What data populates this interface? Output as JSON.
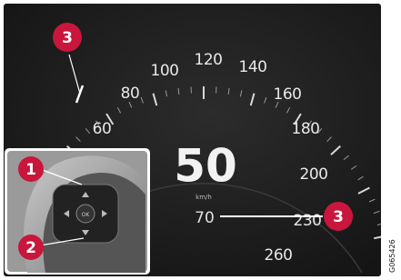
{
  "speedometer": {
    "scale_labels": [
      "60",
      "80",
      "100",
      "120",
      "140",
      "160",
      "180",
      "200",
      "230",
      "260"
    ],
    "current_speed": "50",
    "unit": "km/h",
    "set_speed": "70"
  },
  "callouts": {
    "top_left": "3",
    "right": "3",
    "inset_top": "1",
    "inset_bottom": "2"
  },
  "figure_id": "G065426",
  "colors": {
    "callout": "#c8163c",
    "gauge_bg": "#1e1e1e",
    "marker": "#ffffff"
  }
}
